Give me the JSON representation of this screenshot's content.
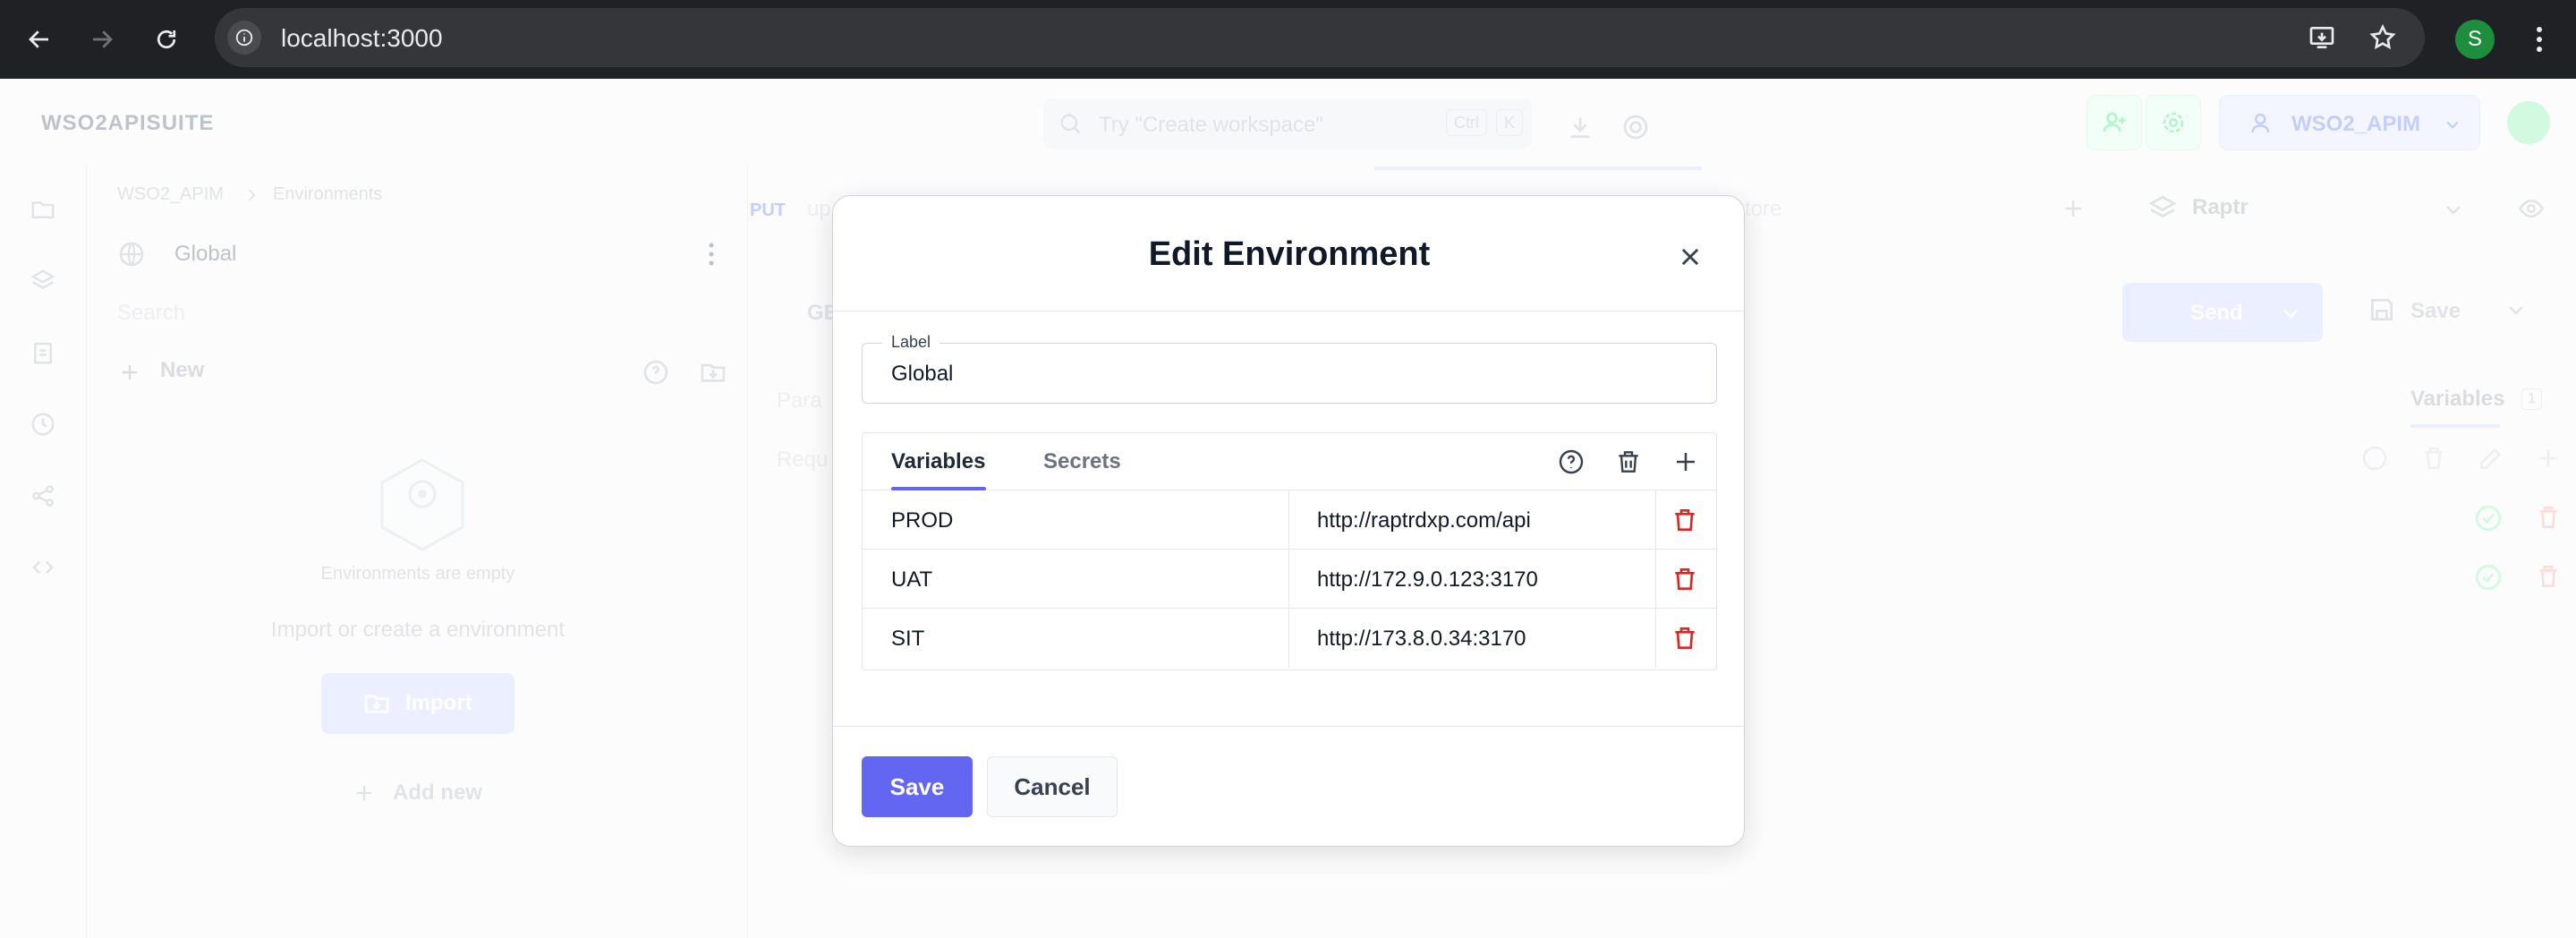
{
  "browser": {
    "url": "localhost:3000",
    "profile_initial": "S"
  },
  "app": {
    "brand": "WSO2APISUITE",
    "search_placeholder": "Try \"Create workspace\"",
    "kbd_ctrl": "Ctrl",
    "kbd_k": "K",
    "workspace": "WSO2_APIM",
    "breadcrumb": [
      "WSO2_APIM",
      "Environments"
    ],
    "env_selected": "Global",
    "sidebar_search": "Search",
    "new_label": "New",
    "empty_title": "Environments are empty",
    "empty_sub": "Import or create a environment",
    "import_label": "Import",
    "add_new_label": "Add new",
    "method": "PUT",
    "req_partial": "up",
    "tab_partial": "tore",
    "collection": "Raptr",
    "get_partial": "GE",
    "send_label": "Send",
    "save_label": "Save",
    "params_partial": "Para",
    "req_partial2": "Requ",
    "variables_label": "Variables",
    "variables_count": "1"
  },
  "modal": {
    "title": "Edit Environment",
    "label_legend": "Label",
    "label_value": "Global",
    "tabs": [
      "Variables",
      "Secrets"
    ],
    "rows": [
      {
        "key": "PROD",
        "value": "http://raptrdxp.com/api"
      },
      {
        "key": "UAT",
        "value": "http://172.9.0.123:3170"
      },
      {
        "key": "SIT",
        "value": "http://173.8.0.34:3170"
      }
    ],
    "save": "Save",
    "cancel": "Cancel"
  },
  "colors": {
    "accent": "#6366f1",
    "danger": "#dc2626"
  }
}
